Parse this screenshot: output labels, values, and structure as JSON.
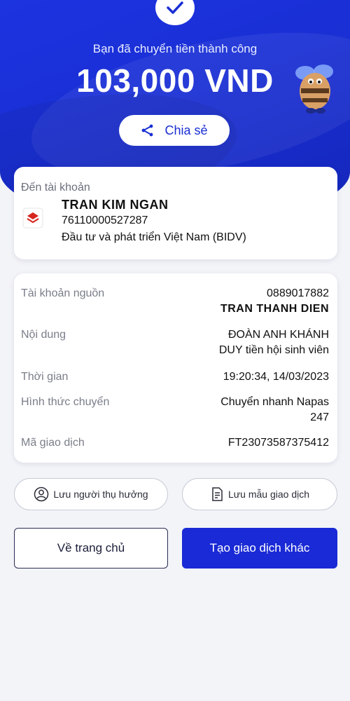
{
  "header": {
    "success_message": "Bạn đã chuyển tiền thành công",
    "amount": "103,000 VND",
    "share_label": "Chia sẻ"
  },
  "recipient": {
    "label": "Đến tài khoản",
    "name": "TRAN KIM NGAN",
    "account_number": "76110000527287",
    "bank": "Đầu tư và phát triển Việt Nam (BIDV)"
  },
  "details": {
    "source_label": "Tài khoản nguồn",
    "source_account": "0889017882",
    "source_name": "TRAN THANH DIEN",
    "content_label": "Nội dung",
    "content_line1": "ĐOÀN ANH KHÁNH",
    "content_line2": "DUY  tiền hội sinh viên",
    "time_label": "Thời gian",
    "time_value": "19:20:34, 14/03/2023",
    "method_label": "Hình thức chuyển",
    "method_line1": "Chuyển nhanh Napas",
    "method_line2": "247",
    "txn_label": "Mã giao dịch",
    "txn_value": "FT23073587375412"
  },
  "actions": {
    "save_beneficiary": "Lưu người thụ hưởng",
    "save_template": "Lưu mẫu giao dịch",
    "home": "Về trang chủ",
    "new_transaction": "Tạo giao dịch khác"
  },
  "colors": {
    "primary": "#1a2fd4",
    "bank_red": "#d7261f"
  }
}
